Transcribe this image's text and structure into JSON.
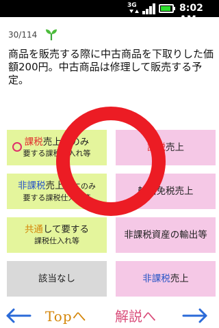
{
  "status_bar": {
    "network": "3G",
    "time": "8:02 AM",
    "icons": [
      "3g-icon",
      "signal-icon",
      "battery-icon"
    ]
  },
  "question": {
    "counter": "30/114",
    "icon": "sprout-icon",
    "text": "商品を販売する際に中古商品を下取りした価額200円。中古商品は修理して販売する予定。"
  },
  "answers": {
    "a1": {
      "part1": "課税",
      "part2": "売上にのみ",
      "sub": "要する課税仕入れ等"
    },
    "a2": {
      "part1": "課税",
      "part2": "売上"
    },
    "a3": {
      "part1": "非課税",
      "part2": "売上げ",
      "part3": "にのみ",
      "sub": "要する課税仕入れ等"
    },
    "a4": {
      "text": "輸出免税売上"
    },
    "a5": {
      "part1": "共通",
      "part2": "して要する",
      "sub": "課税仕入れ等"
    },
    "a6": {
      "text": "非課税資産の輸出等"
    },
    "a7": {
      "text": "該当なし"
    },
    "a8": {
      "part1": "非課税",
      "part2": "売上"
    }
  },
  "navigation": {
    "prev_icon": "arrow-left-icon",
    "top_label": "Topへ",
    "explanation_label": "解説へ",
    "next_icon": "arrow-right-icon"
  },
  "colors": {
    "status_bar_bg": "#000000",
    "answer_green": "#e4f59c",
    "answer_pink": "#f5c8e6",
    "answer_gray": "#d9d9d9",
    "correct_circle": "#ec1c24",
    "text_red": "#e0302e",
    "text_blue": "#2a56c6",
    "text_orange": "#d4860a",
    "nav_arrow": "#2a6ad8"
  }
}
